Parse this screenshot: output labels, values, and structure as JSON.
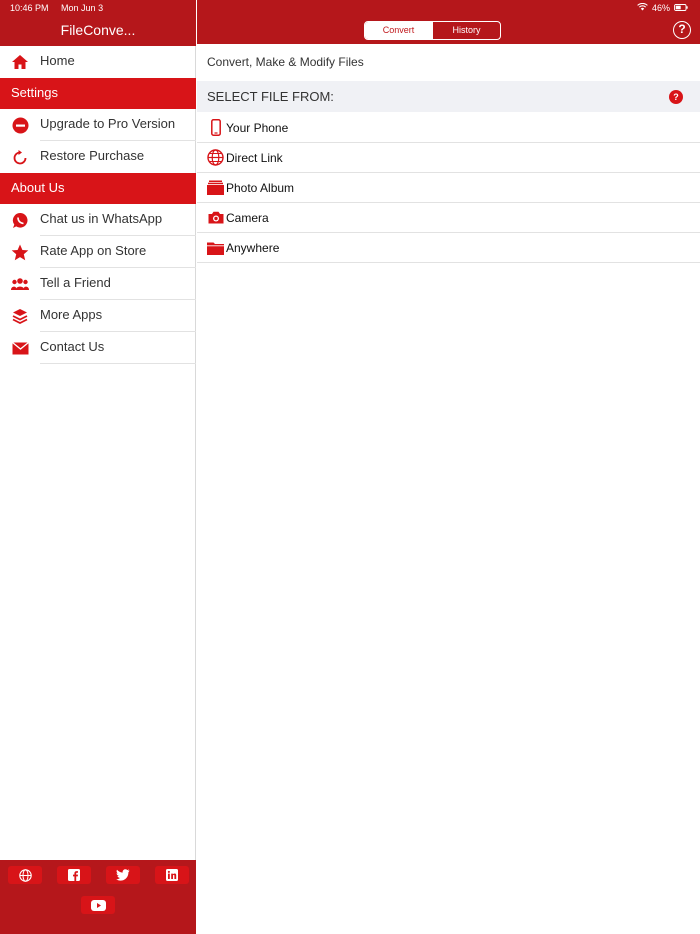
{
  "status": {
    "time": "10:46 PM",
    "date": "Mon Jun 3",
    "battery": "46%"
  },
  "sidebar": {
    "title": "FileConve...",
    "home_label": "Home",
    "settings_header": "Settings",
    "settings_items": [
      {
        "label": "Upgrade to Pro Version",
        "icon": "minus-circle-icon"
      },
      {
        "label": "Restore Purchase",
        "icon": "refresh-icon"
      }
    ],
    "about_header": "About Us",
    "about_items": [
      {
        "label": "Chat us in WhatsApp",
        "icon": "whatsapp-icon"
      },
      {
        "label": "Rate App on Store",
        "icon": "star-icon"
      },
      {
        "label": "Tell a Friend",
        "icon": "people-icon"
      },
      {
        "label": "More Apps",
        "icon": "layers-icon"
      },
      {
        "label": "Contact Us",
        "icon": "envelope-icon"
      }
    ],
    "social": [
      "globe-icon",
      "facebook-icon",
      "twitter-icon",
      "linkedin-icon",
      "youtube-icon"
    ]
  },
  "main": {
    "tabs": {
      "convert": "Convert",
      "history": "History",
      "active": "Convert"
    },
    "help": "?",
    "subtitle": "Convert, Make & Modify Files",
    "section_title": "SELECT FILE FROM:",
    "section_badge": "?",
    "sources": [
      {
        "label": "Your Phone",
        "icon": "phone-icon"
      },
      {
        "label": "Direct Link",
        "icon": "globe-icon"
      },
      {
        "label": "Photo Album",
        "icon": "photo-album-icon"
      },
      {
        "label": "Camera",
        "icon": "camera-icon"
      },
      {
        "label": "Anywhere",
        "icon": "folder-icon"
      }
    ]
  },
  "colors": {
    "brand_dark": "#b5171b",
    "brand": "#d81418"
  }
}
